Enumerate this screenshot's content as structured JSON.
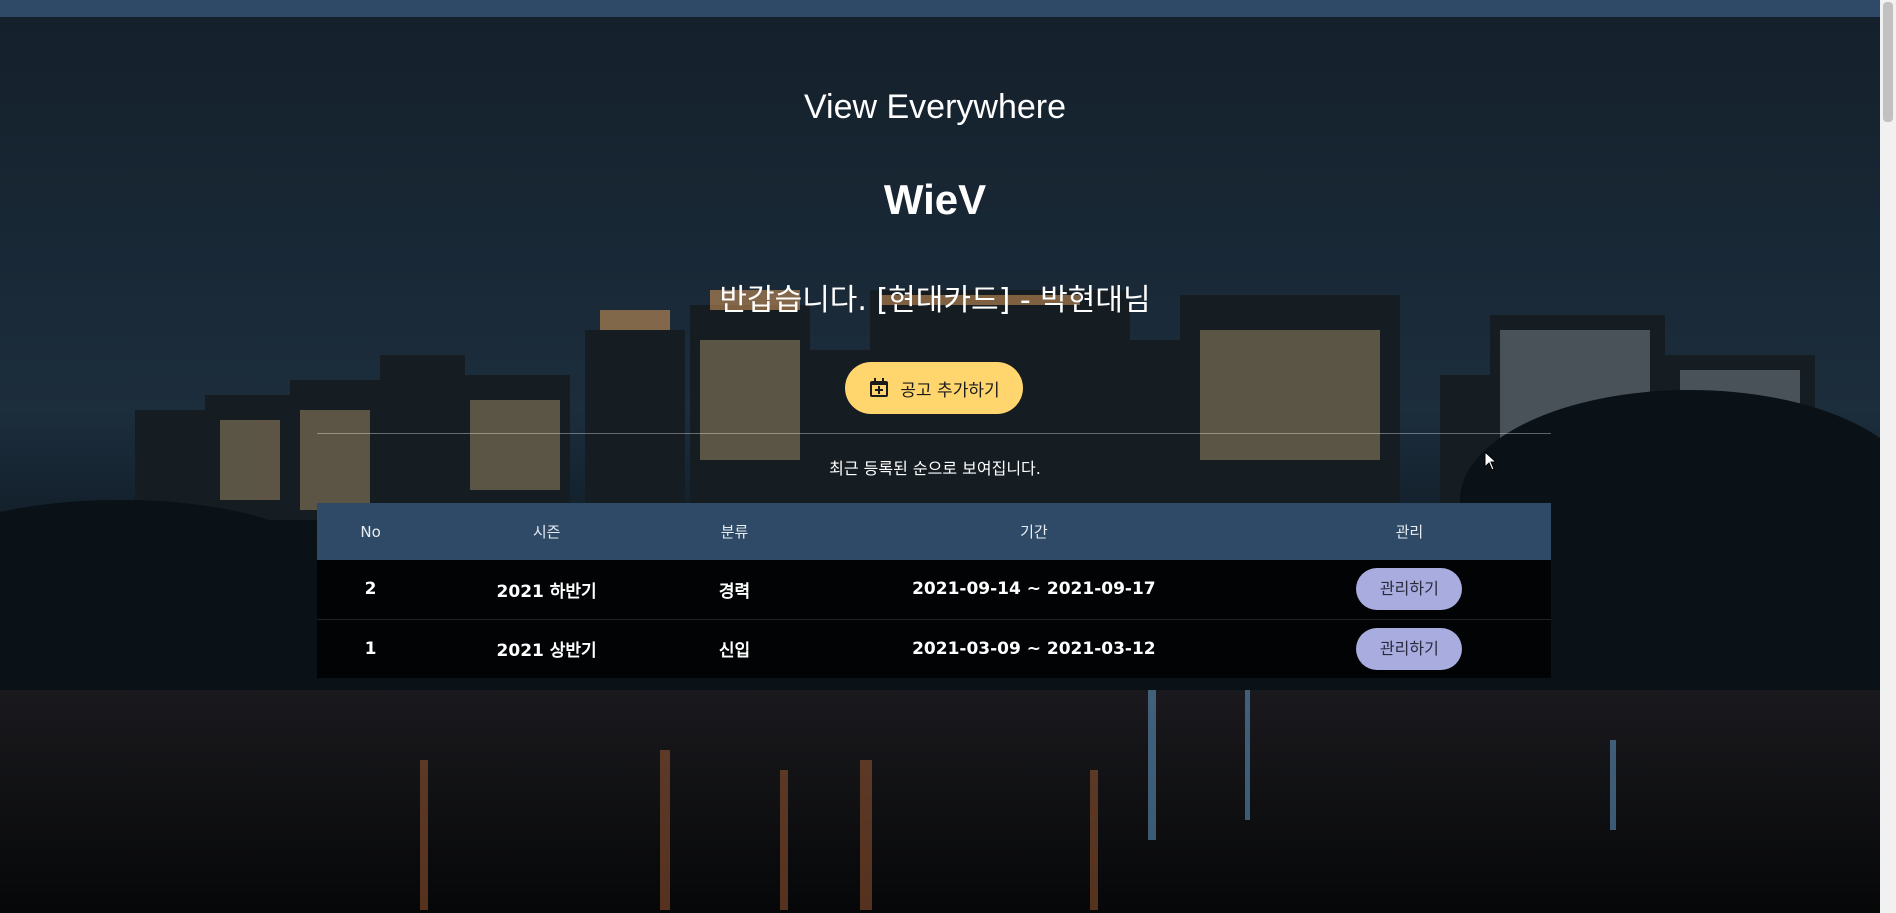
{
  "header": {
    "subtitle": "View Everywhere",
    "brand": "WieV",
    "greeting": "반갑습니다. [현대카드] - 박현대님"
  },
  "actions": {
    "add_posting_label": "공고 추가하기",
    "add_posting_icon": "calendar-plus-icon"
  },
  "notice": "최근 등록된 순으로 보여집니다.",
  "table": {
    "columns": [
      "No",
      "시즌",
      "분류",
      "기간",
      "관리"
    ],
    "rows": [
      {
        "no": "2",
        "season": "2021 하반기",
        "type": "경력",
        "period": "2021-09-14 ~ 2021-09-17",
        "manage_label": "관리하기"
      },
      {
        "no": "1",
        "season": "2021 상반기",
        "type": "신입",
        "period": "2021-03-09 ~ 2021-03-12",
        "manage_label": "관리하기"
      }
    ]
  },
  "colors": {
    "topbar": "#2f4a66",
    "table_header": "#2f4a66",
    "add_button": "#ffd56e",
    "manage_button": "#a8acde"
  }
}
